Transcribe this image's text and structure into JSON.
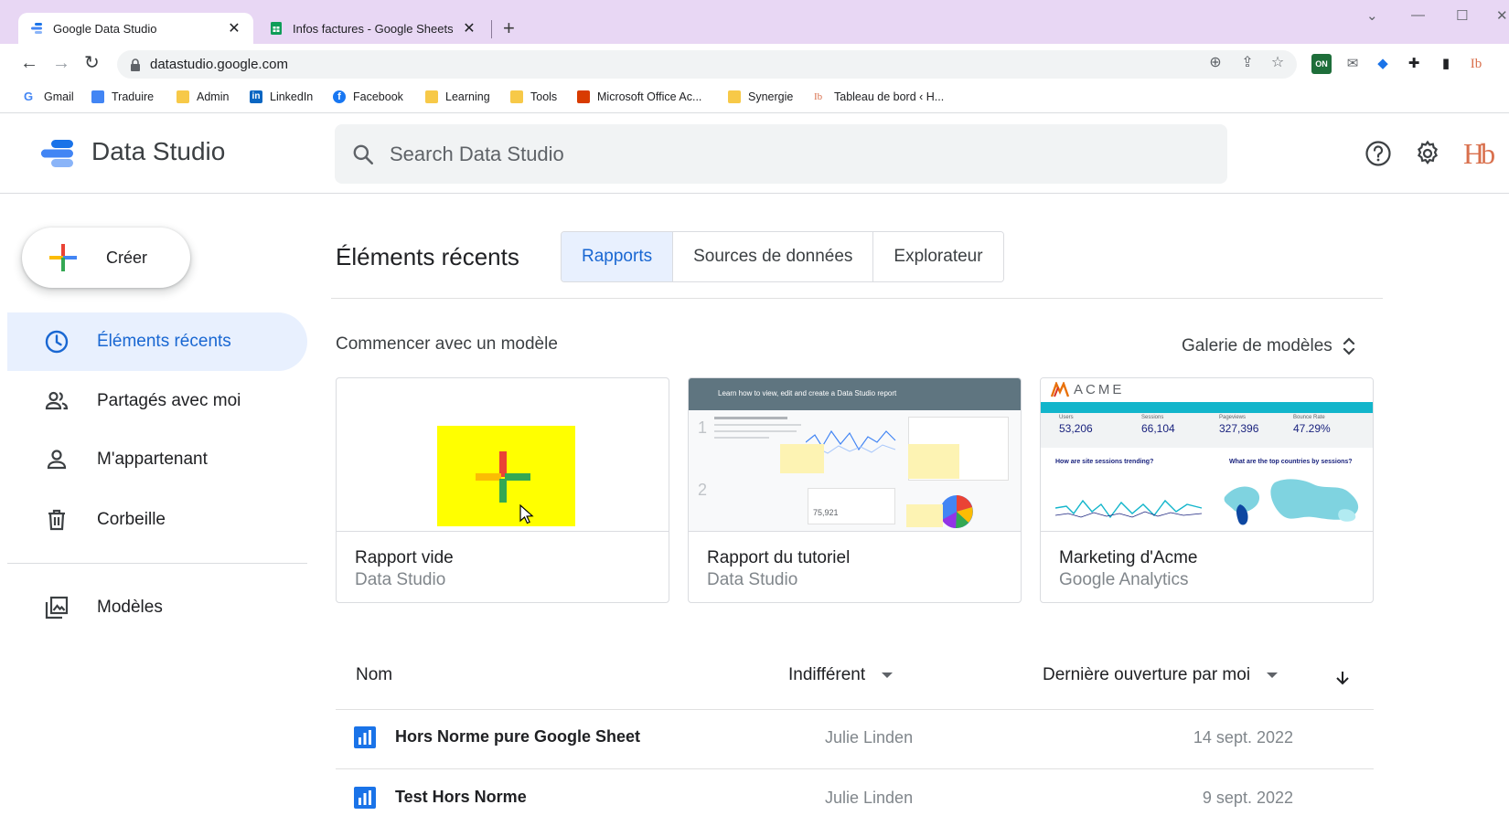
{
  "browser": {
    "tabs": [
      {
        "title": "Google Data Studio",
        "active": true
      },
      {
        "title": "Infos factures - Google Sheets",
        "active": false
      }
    ],
    "url": "datastudio.google.com",
    "bookmarks": [
      {
        "label": "Gmail",
        "icon": "google-icon"
      },
      {
        "label": "Traduire",
        "icon": "translate-icon"
      },
      {
        "label": "Admin",
        "icon": "folder-icon"
      },
      {
        "label": "LinkedIn",
        "icon": "linkedin-icon"
      },
      {
        "label": "Facebook",
        "icon": "facebook-icon"
      },
      {
        "label": "Learning",
        "icon": "folder-icon"
      },
      {
        "label": "Tools",
        "icon": "folder-icon"
      },
      {
        "label": "Microsoft Office Ac...",
        "icon": "office-icon"
      },
      {
        "label": "Synergie",
        "icon": "folder-icon"
      },
      {
        "label": "Tableau de bord ‹ H...",
        "icon": "hb-icon"
      }
    ]
  },
  "header": {
    "app_title": "Data Studio",
    "search_placeholder": "Search Data Studio",
    "brand_mark": "Hb"
  },
  "sidebar": {
    "create_label": "Créer",
    "items": [
      {
        "label": "Éléments récents",
        "icon": "clock-icon",
        "active": true
      },
      {
        "label": "Partagés avec moi",
        "icon": "people-icon",
        "active": false
      },
      {
        "label": "M'appartenant",
        "icon": "person-icon",
        "active": false
      },
      {
        "label": "Corbeille",
        "icon": "trash-icon",
        "active": false
      },
      {
        "label": "Modèles",
        "icon": "templates-icon",
        "active": false
      }
    ]
  },
  "main": {
    "section_title": "Éléments récents",
    "tabs": [
      {
        "label": "Rapports",
        "selected": true
      },
      {
        "label": "Sources de données",
        "selected": false
      },
      {
        "label": "Explorateur",
        "selected": false
      }
    ],
    "start_label": "Commencer avec un modèle",
    "gallery_label": "Galerie de modèles",
    "templates": [
      {
        "title": "Rapport vide",
        "subtitle": "Data Studio"
      },
      {
        "title": "Rapport du tutoriel",
        "subtitle": "Data Studio",
        "thumb_header": "Learn how to view, edit and create a Data Studio report",
        "thumb_stat": "75,921"
      },
      {
        "title": "Marketing d'Acme",
        "subtitle": "Google Analytics",
        "thumb_brand": "ACME",
        "thumb_stats": [
          {
            "label": "Users",
            "value": "53,206"
          },
          {
            "label": "Sessions",
            "value": "66,104"
          },
          {
            "label": "Pageviews",
            "value": "327,396"
          },
          {
            "label": "Bounce Rate",
            "value": "47.29%"
          }
        ],
        "thumb_q1": "How are site sessions trending?",
        "thumb_q2": "What are the top countries by sessions?"
      }
    ],
    "table": {
      "col_name": "Nom",
      "col_owner": "Indifférent",
      "col_date": "Dernière ouverture par moi",
      "rows": [
        {
          "name": "Hors Norme pure Google Sheet",
          "owner": "Julie Linden",
          "date": "14 sept. 2022"
        },
        {
          "name": "Test Hors Norme",
          "owner": "Julie Linden",
          "date": "9 sept. 2022"
        }
      ]
    }
  }
}
